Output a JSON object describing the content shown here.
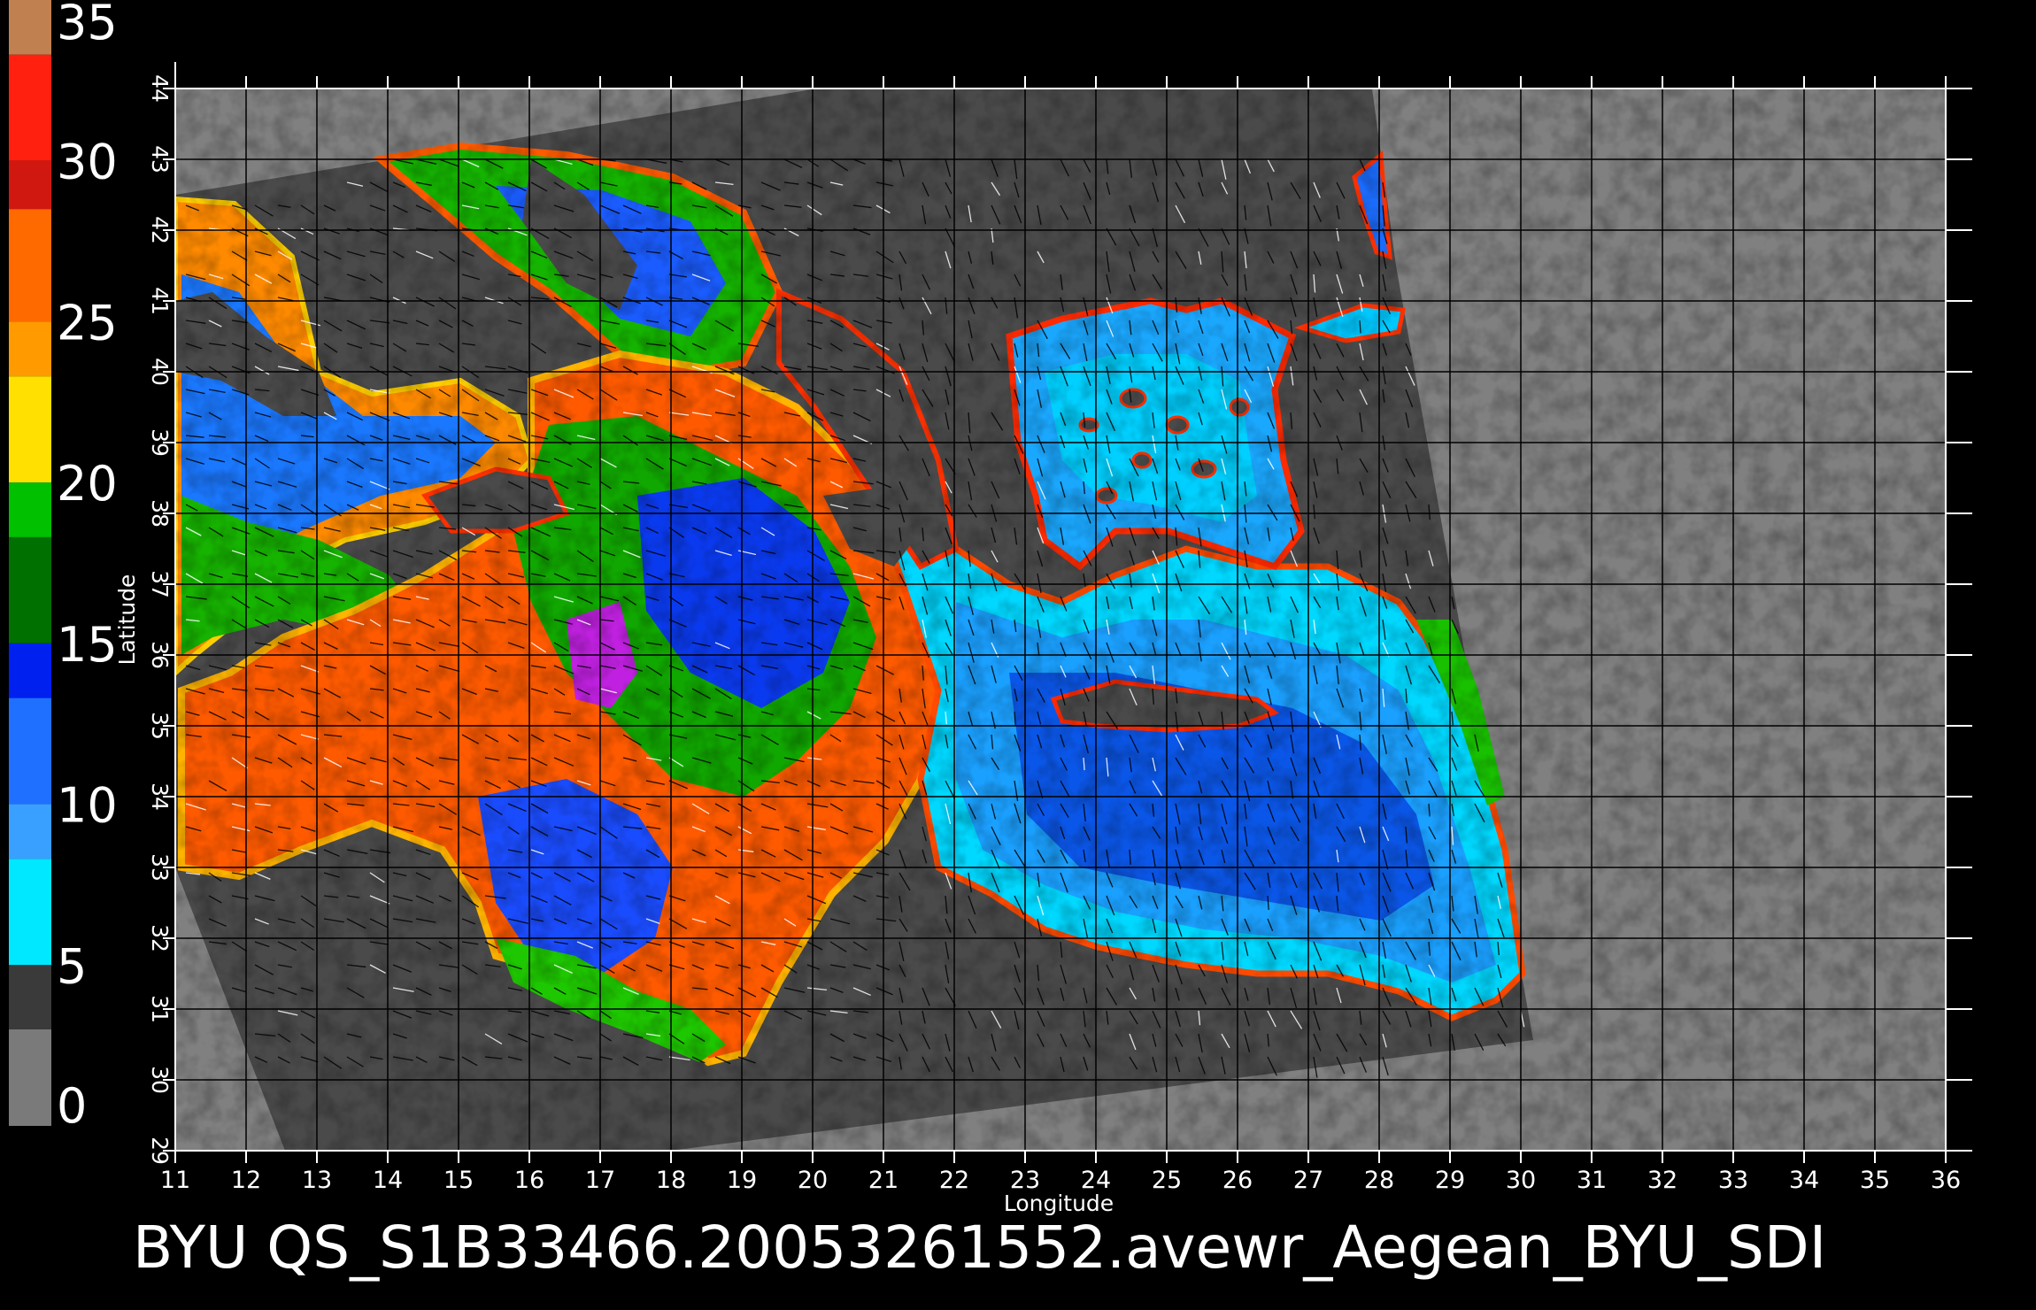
{
  "product": {
    "caption": "BYU  QS_S1B33466.20053261552.avewr_Aegean_BYU_SDI"
  },
  "colorbar": {
    "labels": [
      "35",
      "30",
      "25",
      "20",
      "15",
      "10",
      "5",
      "0"
    ],
    "segments": [
      {
        "from": 33.3,
        "to": 35,
        "color": "#c08050"
      },
      {
        "from": 30,
        "to": 33.3,
        "color": "#ff2010"
      },
      {
        "from": 28.5,
        "to": 30,
        "color": "#d01810"
      },
      {
        "from": 25,
        "to": 28.5,
        "color": "#ff6a00"
      },
      {
        "from": 23.3,
        "to": 25,
        "color": "#ff9a00"
      },
      {
        "from": 20,
        "to": 23.3,
        "color": "#ffe000"
      },
      {
        "from": 18.3,
        "to": 20,
        "color": "#00c000"
      },
      {
        "from": 15,
        "to": 18.3,
        "color": "#007000"
      },
      {
        "from": 13.3,
        "to": 15,
        "color": "#0020f0"
      },
      {
        "from": 10,
        "to": 13.3,
        "color": "#2070ff"
      },
      {
        "from": 8.3,
        "to": 10,
        "color": "#3aa0ff"
      },
      {
        "from": 5,
        "to": 8.3,
        "color": "#00e8ff"
      },
      {
        "from": 3,
        "to": 5,
        "color": "#3a3a3a"
      },
      {
        "from": 0,
        "to": 3,
        "color": "#7a7a7a"
      }
    ]
  },
  "axes": {
    "xlabel": "Longitude",
    "ylabel": "Latitude",
    "lon_ticks": [
      "11",
      "12",
      "13",
      "14",
      "15",
      "16",
      "17",
      "18",
      "19",
      "20",
      "21",
      "22",
      "23",
      "24",
      "25",
      "26",
      "27",
      "28",
      "29",
      "30",
      "31",
      "32",
      "33",
      "34",
      "35",
      "36"
    ],
    "lat_ticks": [
      "29",
      "30",
      "31",
      "32",
      "33",
      "34",
      "35",
      "36",
      "37",
      "38",
      "39",
      "40",
      "41",
      "42",
      "43",
      "44"
    ],
    "lon_range": [
      11,
      36
    ],
    "lat_range": [
      29,
      44
    ]
  },
  "colors": {
    "background": "#000000",
    "no_data": "#808080",
    "land": "#4a4a4a",
    "grid": "#000000"
  }
}
